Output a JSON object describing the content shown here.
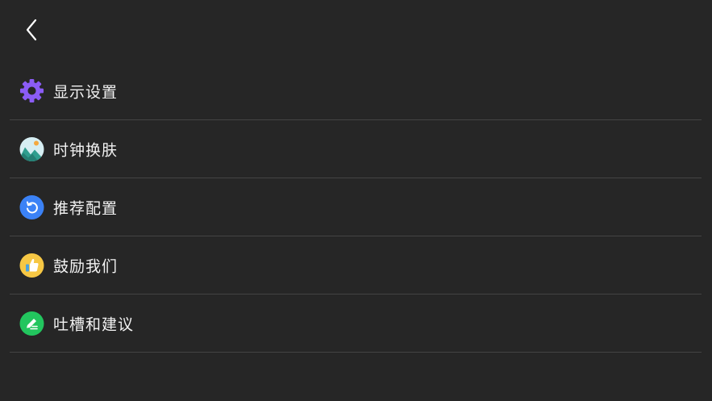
{
  "header": {
    "back_icon": "chevron-left-icon"
  },
  "menu": {
    "items": [
      {
        "label": "显示设置",
        "icon": "gear-icon",
        "color": "#8b5cf6"
      },
      {
        "label": "时钟换肤",
        "icon": "landscape-icon",
        "color": "#38b2ac"
      },
      {
        "label": "推荐配置",
        "icon": "refresh-icon",
        "color": "#3b82f6"
      },
      {
        "label": "鼓励我们",
        "icon": "thumbs-up-icon",
        "color": "#f6c744"
      },
      {
        "label": "吐槽和建议",
        "icon": "edit-icon",
        "color": "#22c55e"
      }
    ]
  }
}
